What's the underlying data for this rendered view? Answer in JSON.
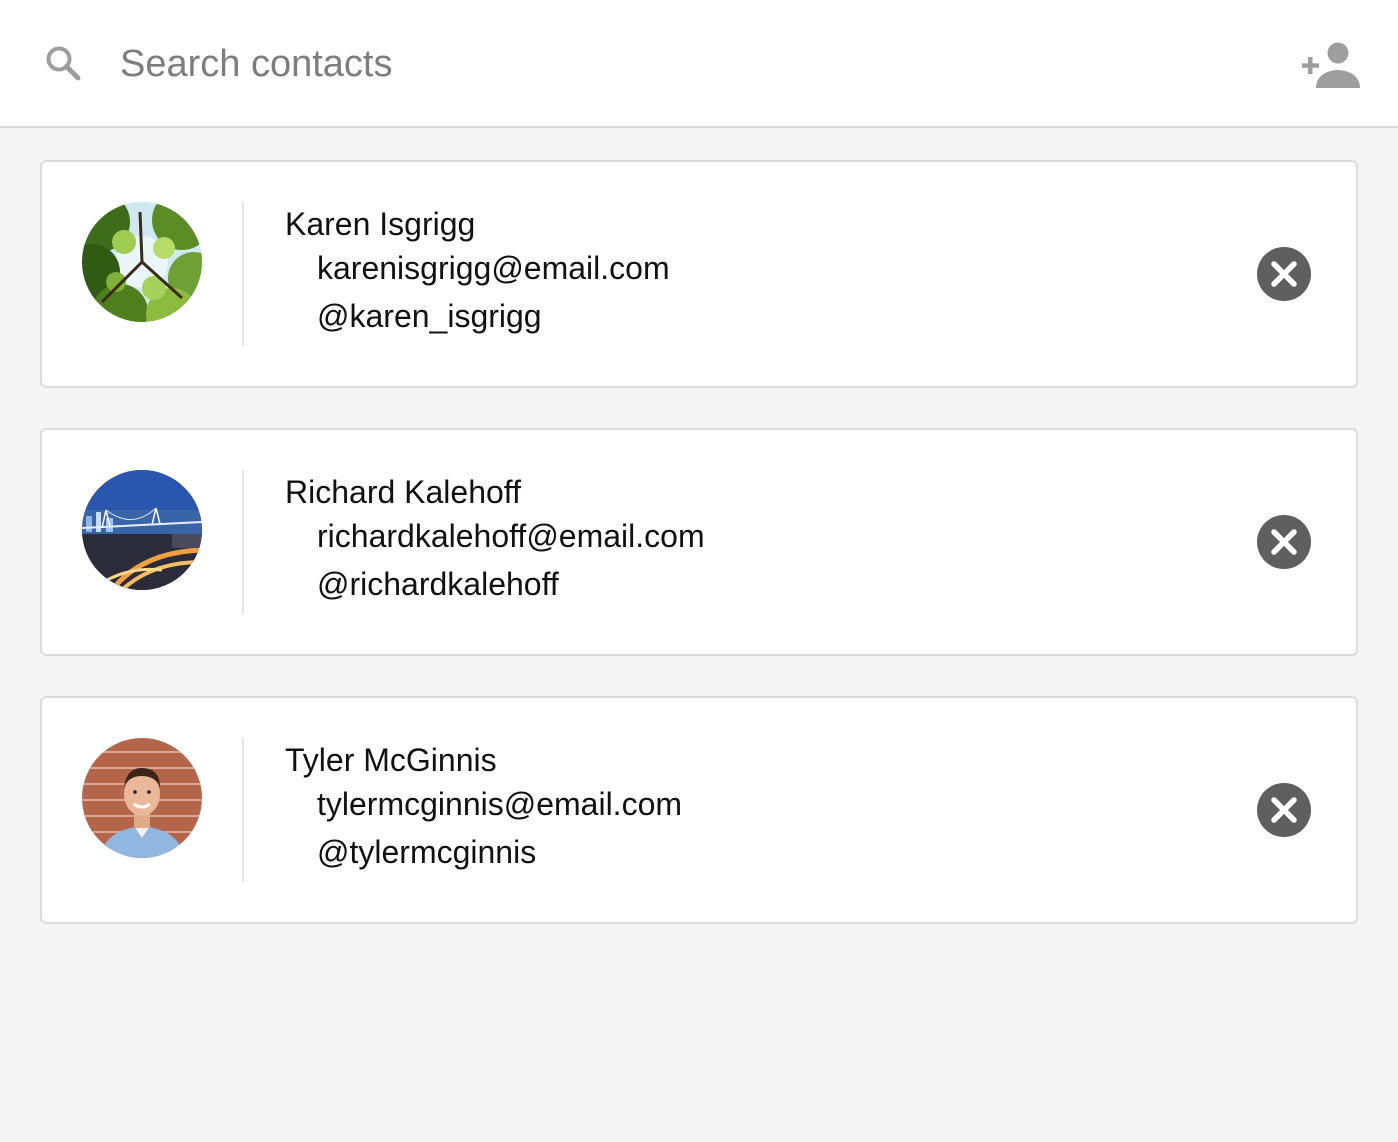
{
  "search": {
    "placeholder": "Search contacts",
    "icon": "search-icon"
  },
  "header": {
    "add_icon": "person-add-icon"
  },
  "contacts": [
    {
      "name": "Karen Isgrigg",
      "email": "karenisgrigg@email.com",
      "handle": "@karen_isgrigg",
      "avatar": "tree-canopy-photo"
    },
    {
      "name": "Richard Kalehoff",
      "email": "richardkalehoff@email.com",
      "handle": "@richardkalehoff",
      "avatar": "city-bridge-night-photo"
    },
    {
      "name": "Tyler McGinnis",
      "email": "tylermcginnis@email.com",
      "handle": "@tylermcginnis",
      "avatar": "portrait-photo"
    }
  ],
  "colors": {
    "background": "#f4f4f4",
    "card": "#ffffff",
    "border": "#dcdcdc",
    "remove_button": "#5f5f5f",
    "icon_gray": "#9e9e9e"
  }
}
